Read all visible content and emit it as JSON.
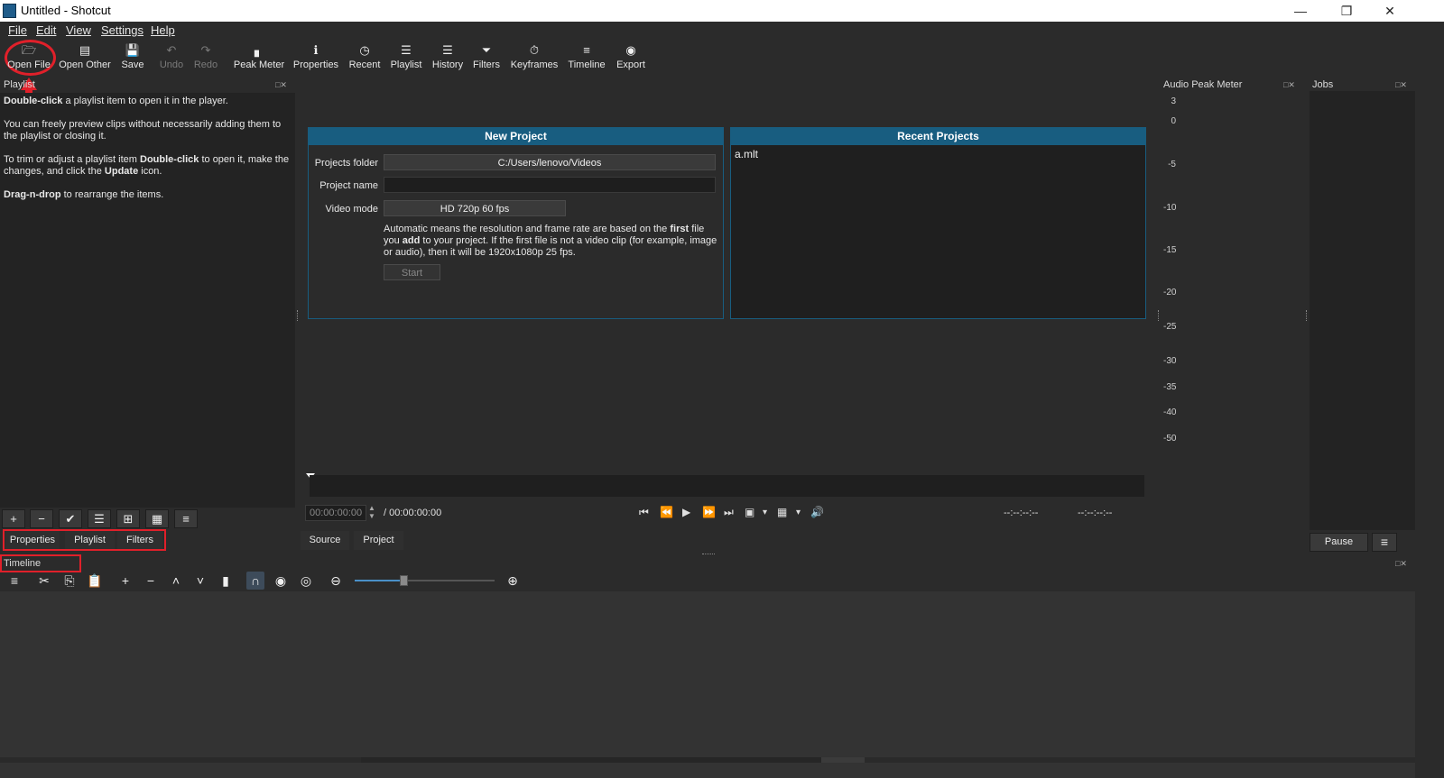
{
  "window": {
    "title": "Untitled - Shotcut",
    "minimize": "—",
    "restore": "❐",
    "close": "✕"
  },
  "menu": [
    "File",
    "Edit",
    "View",
    "Settings",
    "Help"
  ],
  "toolbar": [
    {
      "label": "Open File",
      "icon": "folder-open-icon",
      "glyph": "🗁"
    },
    {
      "label": "Open Other",
      "icon": "open-other-icon",
      "glyph": "▤"
    },
    {
      "label": "Save",
      "icon": "save-icon",
      "glyph": "💾"
    },
    {
      "label": "Undo",
      "icon": "undo-icon",
      "glyph": "↶",
      "disabled": true
    },
    {
      "label": "Redo",
      "icon": "redo-icon",
      "glyph": "↷",
      "disabled": true
    },
    {
      "label": "Peak Meter",
      "icon": "peak-meter-icon",
      "glyph": "▖"
    },
    {
      "label": "Properties",
      "icon": "info-icon",
      "glyph": "ℹ"
    },
    {
      "label": "Recent",
      "icon": "clock-icon",
      "glyph": "◷"
    },
    {
      "label": "Playlist",
      "icon": "list-icon",
      "glyph": "☰"
    },
    {
      "label": "History",
      "icon": "history-icon",
      "glyph": "☰"
    },
    {
      "label": "Filters",
      "icon": "funnel-icon",
      "glyph": "⏷"
    },
    {
      "label": "Keyframes",
      "icon": "stopwatch-icon",
      "glyph": "⏱"
    },
    {
      "label": "Timeline",
      "icon": "timeline-icon",
      "glyph": "≡"
    },
    {
      "label": "Export",
      "icon": "export-icon",
      "glyph": "◉"
    }
  ],
  "playlist": {
    "title": "Playlist",
    "help": [
      [
        {
          "b": "Double-click"
        },
        {
          "t": " a playlist item to open it in the player."
        }
      ],
      [
        {
          "t": "You can freely preview clips without necessarily adding them to the playlist or closing it."
        }
      ],
      [
        {
          "t": "To trim or adjust a playlist item "
        },
        {
          "b": "Double-click"
        },
        {
          "t": " to open it, make the changes, and click the "
        },
        {
          "b": "Update"
        },
        {
          "t": " icon."
        }
      ],
      [
        {
          "b": "Drag-n-drop"
        },
        {
          "t": " to rearrange the items."
        }
      ]
    ],
    "buttons": [
      {
        "icon": "plus-icon",
        "glyph": "+"
      },
      {
        "icon": "minus-icon",
        "glyph": "−"
      },
      {
        "icon": "check-icon",
        "glyph": "✔"
      },
      {
        "icon": "details-view-icon",
        "glyph": "☰"
      },
      {
        "icon": "tiles-view-icon",
        "glyph": "⊞"
      },
      {
        "icon": "icons-view-icon",
        "glyph": "▦"
      },
      {
        "icon": "menu-icon",
        "glyph": "≡"
      }
    ]
  },
  "bottom_tabs": [
    "Properties",
    "Playlist",
    "Filters"
  ],
  "new_project": {
    "header": "New Project",
    "folder_label": "Projects folder",
    "folder_value": "C:/Users/lenovo/Videos",
    "name_label": "Project name",
    "name_value": "",
    "mode_label": "Video mode",
    "mode_value": "HD 720p 60 fps",
    "note": [
      {
        "t": "Automatic means the resolution and frame rate are based on the "
      },
      {
        "b": "first"
      },
      {
        "t": " file you "
      },
      {
        "b": "add"
      },
      {
        "t": " to your project. If the first file is not a video clip (for example, image or audio), then it will be 1920x1080p 25 fps."
      }
    ],
    "start_label": "Start"
  },
  "recent_projects": {
    "header": "Recent Projects",
    "items": [
      "a.mlt"
    ]
  },
  "player": {
    "position": "00:00:00:00",
    "duration": "/ 00:00:00:00",
    "in_point": "--:--:--:--",
    "out_point": "--:--:--:--",
    "tabs": [
      "Source",
      "Project"
    ],
    "controls": [
      {
        "icon": "skip-to-start-icon",
        "glyph": "⏮"
      },
      {
        "icon": "rewind-icon",
        "glyph": "⏪"
      },
      {
        "icon": "play-icon",
        "glyph": "▶"
      },
      {
        "icon": "fast-forward-icon",
        "glyph": "⏩"
      },
      {
        "icon": "skip-to-end-icon",
        "glyph": "⏭"
      },
      {
        "icon": "zoom-fit-icon",
        "glyph": "▣"
      },
      {
        "icon": "dropdown-arrow-icon",
        "glyph": "▾"
      },
      {
        "icon": "grid-icon",
        "glyph": "▦"
      },
      {
        "icon": "dropdown-arrow-icon",
        "glyph": "▾"
      },
      {
        "icon": "volume-icon",
        "glyph": "🔊"
      }
    ]
  },
  "audio_meter": {
    "title": "Audio Peak Meter",
    "ticks": [
      "3",
      "0",
      "-5",
      "-10",
      "-15",
      "-20",
      "-25",
      "-30",
      "-35",
      "-40",
      "-50"
    ]
  },
  "jobs": {
    "title": "Jobs",
    "pause_label": "Pause",
    "menu_glyph": "≡"
  },
  "timeline": {
    "title": "Timeline",
    "zoom_level": 0.35,
    "tools": [
      {
        "icon": "menu-icon",
        "glyph": "≡"
      },
      {
        "icon": "cut-icon",
        "glyph": "✂"
      },
      {
        "icon": "copy-icon",
        "glyph": "⎘"
      },
      {
        "icon": "paste-icon",
        "glyph": "📋"
      },
      {
        "icon": "append-icon",
        "glyph": "+"
      },
      {
        "icon": "ripple-delete-icon",
        "glyph": "−"
      },
      {
        "icon": "lift-icon",
        "glyph": "˄"
      },
      {
        "icon": "overwrite-icon",
        "glyph": "˅"
      },
      {
        "icon": "split-icon",
        "glyph": "▮"
      },
      {
        "icon": "snap-magnet-icon",
        "glyph": "∩"
      },
      {
        "icon": "scrub-eye-icon",
        "glyph": "◉"
      },
      {
        "icon": "ripple-target-icon",
        "glyph": "◎"
      },
      {
        "icon": "zoom-out-icon",
        "glyph": "⊖"
      },
      {
        "icon": "zoom-in-icon",
        "glyph": "⊕"
      }
    ]
  },
  "float_icons": "□✕"
}
